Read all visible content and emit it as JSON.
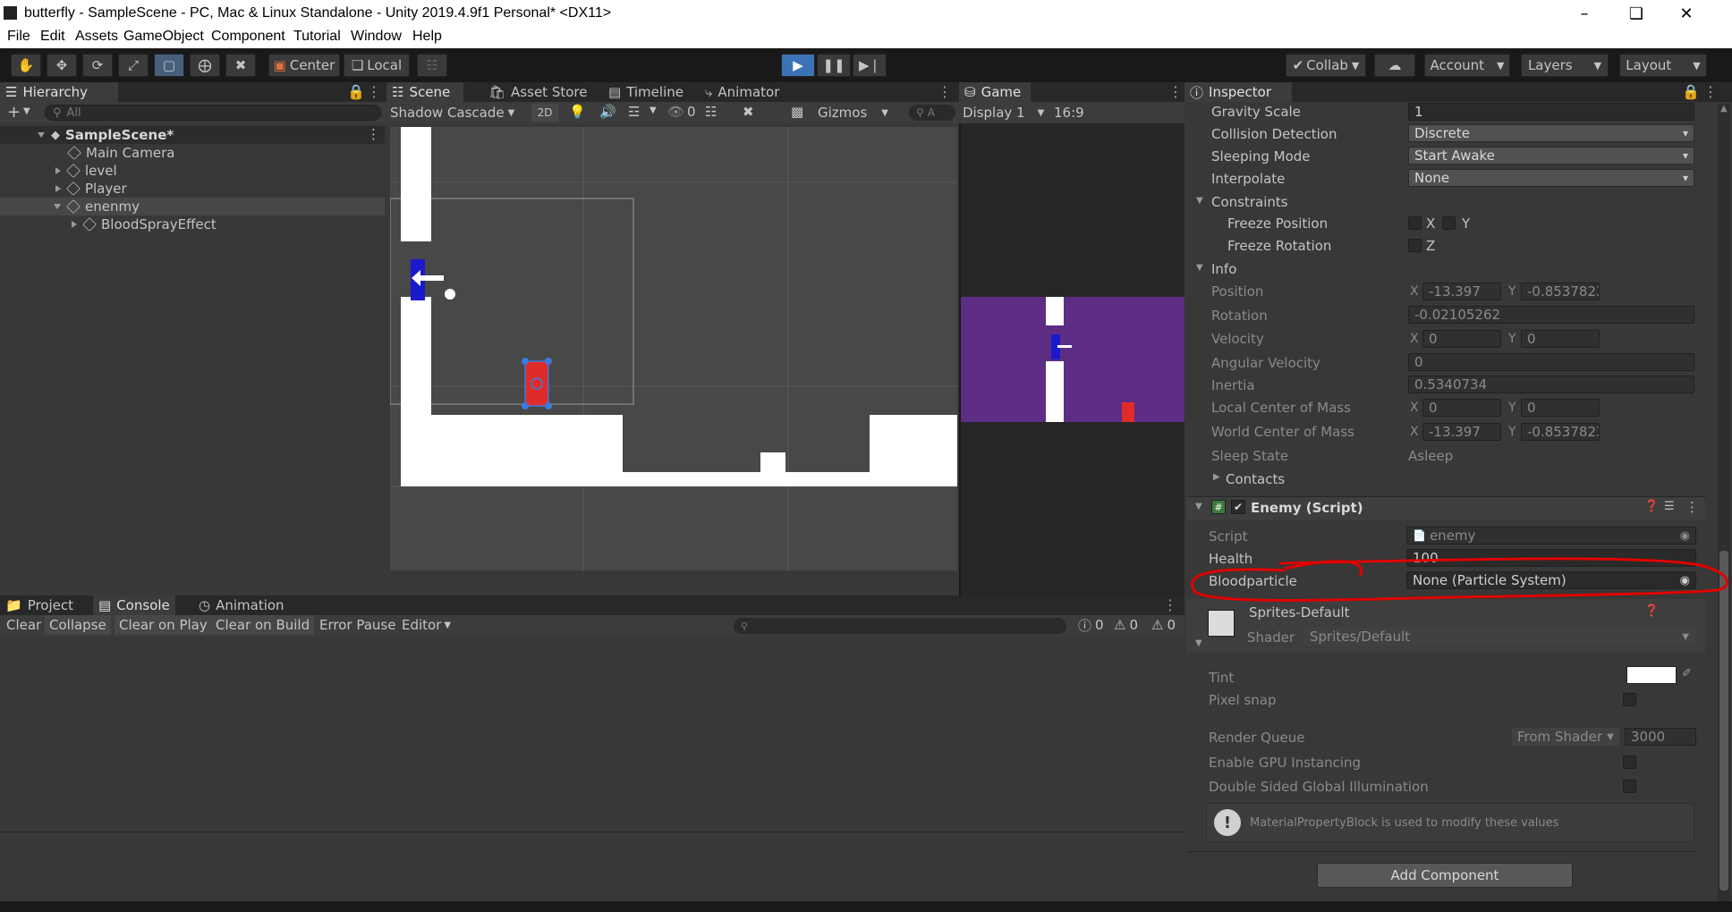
{
  "window": {
    "title": "butterfly - SampleScene - PC, Mac & Linux Standalone - Unity 2019.4.9f1 Personal* <DX11>"
  },
  "menu": [
    "File",
    "Edit",
    "Assets",
    "GameObject",
    "Component",
    "Tutorial",
    "Window",
    "Help"
  ],
  "toolbar": {
    "pivot_label": "Center",
    "space_label": "Local",
    "collab_label": "Collab",
    "account_label": "Account",
    "layers_label": "Layers",
    "layout_label": "Layout"
  },
  "hierarchy": {
    "tab_label": "Hierarchy",
    "search_placeholder": "All",
    "scene_name": "SampleScene*",
    "items": [
      {
        "label": "Main Camera"
      },
      {
        "label": "level"
      },
      {
        "label": "Player"
      },
      {
        "label": "enenmy"
      },
      {
        "label": "BloodSprayEffect"
      }
    ]
  },
  "scene": {
    "tabs": [
      "Scene",
      "Asset Store",
      "Timeline",
      "Animator"
    ],
    "shading_mode": "Shadow Cascade",
    "mode_2d": "2D",
    "hidden_count": "0",
    "gizmos_label": "Gizmos",
    "search_placeholder": "A"
  },
  "game": {
    "tab_label": "Game",
    "display": "Display 1",
    "aspect": "16:9"
  },
  "console": {
    "tabs": [
      "Project",
      "Console",
      "Animation"
    ],
    "buttons": [
      "Clear",
      "Collapse",
      "Clear on Play",
      "Clear on Build",
      "Error Pause",
      "Editor"
    ],
    "info_count": "0",
    "warn_count": "0",
    "error_count": "0"
  },
  "inspector": {
    "tab_label": "Inspector",
    "gravity_scale": {
      "label": "Gravity Scale",
      "value": "1"
    },
    "collision_detection": {
      "label": "Collision Detection",
      "value": "Discrete"
    },
    "sleeping_mode": {
      "label": "Sleeping Mode",
      "value": "Start Awake"
    },
    "interpolate": {
      "label": "Interpolate",
      "value": "None"
    },
    "constraints_label": "Constraints",
    "freeze_position_label": "Freeze Position",
    "freeze_rotation_label": "Freeze Rotation",
    "axis_x": "X",
    "axis_y": "Y",
    "axis_z": "Z",
    "info_label": "Info",
    "position": {
      "label": "Position",
      "x": "-13.397",
      "y": "-0.8537823"
    },
    "rotation": {
      "label": "Rotation",
      "value": "-0.02105262"
    },
    "velocity": {
      "label": "Velocity",
      "x": "0",
      "y": "0"
    },
    "angular_velocity": {
      "label": "Angular Velocity",
      "value": "0"
    },
    "inertia": {
      "label": "Inertia",
      "value": "0.5340734"
    },
    "local_com": {
      "label": "Local Center of Mass",
      "x": "0",
      "y": "0"
    },
    "world_com": {
      "label": "World Center of Mass",
      "x": "-13.397",
      "y": "-0.8537823"
    },
    "sleep_state": {
      "label": "Sleep State",
      "value": "Asleep"
    },
    "contacts_label": "Contacts",
    "enemy_script": {
      "header": "Enemy (Script)",
      "script_label": "Script",
      "script_value": "enemy",
      "health_label": "Health",
      "health_value": "100",
      "blood_label": "Bloodparticle",
      "blood_value": "None (Particle System)"
    },
    "material": {
      "name": "Sprites-Default",
      "shader_label": "Shader",
      "shader_value": "Sprites/Default",
      "tint_label": "Tint",
      "pixel_snap_label": "Pixel snap",
      "render_queue_label": "Render Queue",
      "render_queue_mode": "From Shader",
      "render_queue_value": "3000",
      "gpu_instancing_label": "Enable GPU Instancing",
      "double_sided_label": "Double Sided Global Illumination",
      "info_message": "MaterialPropertyBlock is used to modify these values"
    },
    "add_component_label": "Add Component"
  },
  "colors": {
    "editor_dark": "#191919",
    "panel": "#383838",
    "scene_bg": "#484848",
    "game_bg": "#5c2d82",
    "player_blue": "#1a1acc",
    "enemy_red": "#e02b2b",
    "annotation_red": "#e00000",
    "play_blue": "#3b73b6"
  }
}
